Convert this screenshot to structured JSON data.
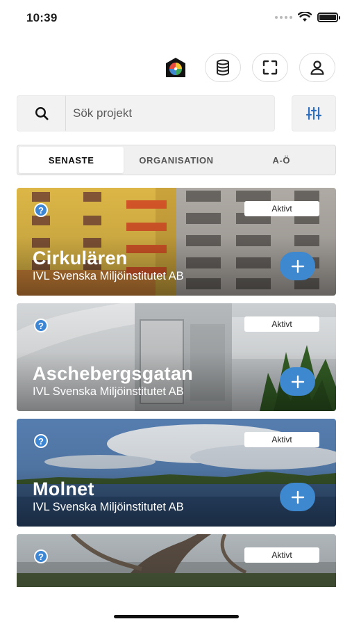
{
  "status_bar": {
    "time": "10:39"
  },
  "toolbar": {
    "logo_icon": "app-logo-icon",
    "buttons": [
      {
        "name": "database-button",
        "icon": "database-icon"
      },
      {
        "name": "scan-button",
        "icon": "scan-frame-icon"
      },
      {
        "name": "profile-button",
        "icon": "user-icon"
      }
    ]
  },
  "search": {
    "placeholder": "Sök projekt",
    "value": ""
  },
  "tabs": [
    {
      "label": "SENASTE",
      "active": true
    },
    {
      "label": "ORGANISATION",
      "active": false
    },
    {
      "label": "A-Ö",
      "active": false
    }
  ],
  "projects": [
    {
      "title": "Cirkulären",
      "org": "IVL Svenska Miljöinstitutet AB",
      "status": "Aktivt"
    },
    {
      "title": "Aschebergsgatan",
      "org": "IVL Svenska Miljöinstitutet AB",
      "status": "Aktivt"
    },
    {
      "title": "Molnet",
      "org": "IVL Svenska Miljöinstitutet AB",
      "status": "Aktivt"
    },
    {
      "title": "",
      "org": "",
      "status": "Aktivt"
    }
  ],
  "colors": {
    "accent": "#3e88cf",
    "filter_icon": "#2f6fc0"
  }
}
